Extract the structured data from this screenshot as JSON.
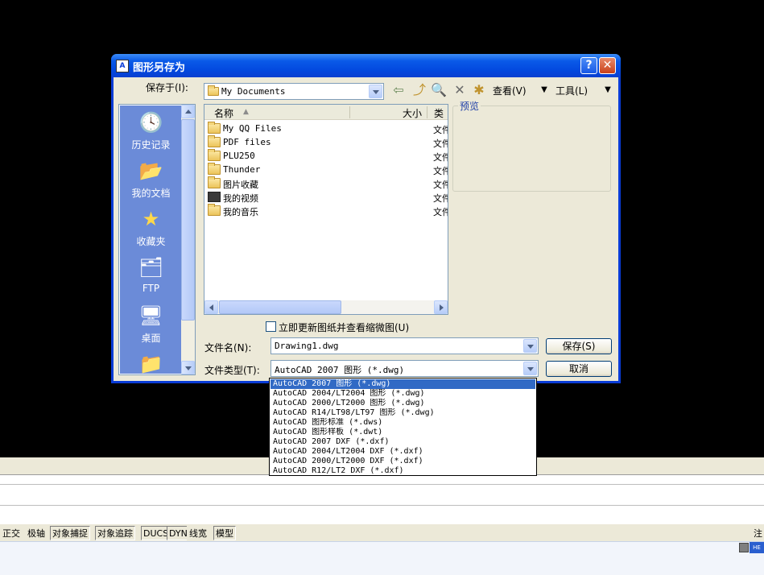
{
  "dialog": {
    "title": "图形另存为",
    "help_label": "?",
    "close_label": "✕",
    "save_in_label": "保存于(I):",
    "save_in_value": "My Documents",
    "toolbar": {
      "view_label": "查看(V)",
      "tools_label": "工具(L)"
    },
    "places": [
      {
        "label": "历史记录",
        "icon": "history-icon"
      },
      {
        "label": "我的文档",
        "icon": "my-documents-icon"
      },
      {
        "label": "收藏夹",
        "icon": "favorites-icon"
      },
      {
        "label": "FTP",
        "icon": "ftp-icon"
      },
      {
        "label": "桌面",
        "icon": "desktop-icon"
      }
    ],
    "file_list": {
      "columns": {
        "name": "名称",
        "size": "大小",
        "type": "类"
      },
      "files": [
        {
          "name": "My QQ Files",
          "type": "文件",
          "icon": "folder-icon"
        },
        {
          "name": "PDF files",
          "type": "文件",
          "icon": "folder-icon"
        },
        {
          "name": "PLU250",
          "type": "文件",
          "icon": "folder-icon"
        },
        {
          "name": "Thunder",
          "type": "文件",
          "icon": "folder-icon"
        },
        {
          "name": "图片收藏",
          "type": "文件",
          "icon": "pictures-folder-icon"
        },
        {
          "name": "我的视频",
          "type": "文件",
          "icon": "videos-folder-icon"
        },
        {
          "name": "我的音乐",
          "type": "文件",
          "icon": "music-folder-icon"
        }
      ]
    },
    "preview_label": "预览",
    "update_thumbnail_label": "立即更新图纸并查看缩微图(U)",
    "update_thumbnail_checked": false,
    "filename_label": "文件名(N):",
    "filename_value": "Drawing1.dwg",
    "filetype_label": "文件类型(T):",
    "filetype_value": "AutoCAD 2007 图形 (*.dwg)",
    "save_button": "保存(S)",
    "cancel_button": "取消",
    "filetype_options": [
      "AutoCAD 2007 图形 (*.dwg)",
      "AutoCAD 2004/LT2004 图形 (*.dwg)",
      "AutoCAD 2000/LT2000 图形 (*.dwg)",
      "AutoCAD R14/LT98/LT97 图形 (*.dwg)",
      "AutoCAD 图形标准 (*.dws)",
      "AutoCAD 图形样板 (*.dwt)",
      "AutoCAD 2007 DXF (*.dxf)",
      "AutoCAD 2004/LT2004 DXF (*.dxf)",
      "AutoCAD 2000/LT2000 DXF (*.dxf)",
      "AutoCAD R12/LT2 DXF (*.dxf)"
    ],
    "filetype_selected_index": 0
  },
  "statusbar": {
    "buttons": [
      "正交",
      "极轴",
      "对象捕捉",
      "对象追踪",
      "DUCS",
      "DYN",
      "线宽",
      "模型"
    ],
    "right_text": "注"
  },
  "taskbar": {
    "badge": "HE"
  },
  "colors": {
    "title_blue": "#0a3cd6",
    "canvas": "#000000",
    "selection": "#316ac5",
    "places_bar": "#6b8bd8"
  }
}
